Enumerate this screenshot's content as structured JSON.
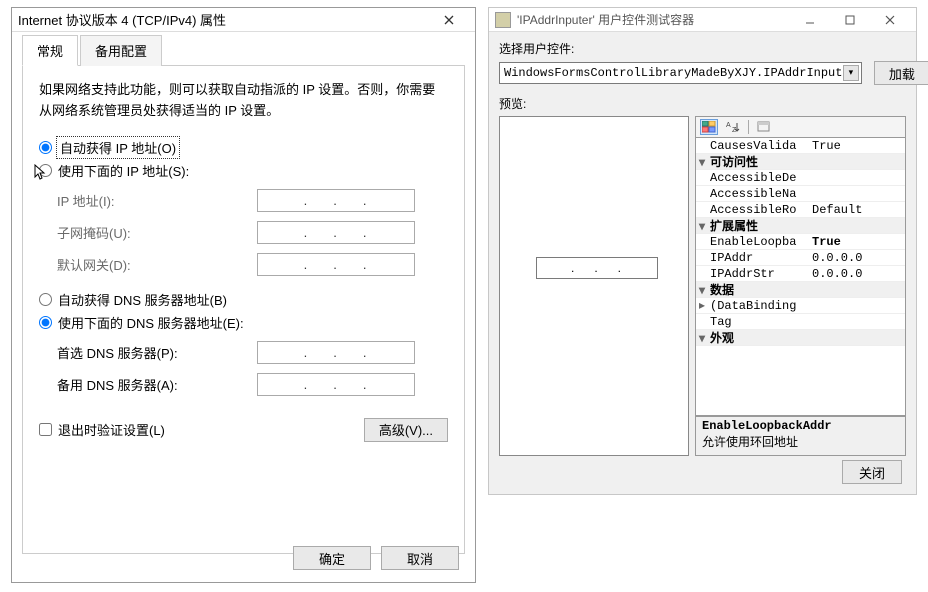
{
  "left": {
    "title": "Internet 协议版本 4 (TCP/IPv4) 属性",
    "tabs": {
      "general": "常规",
      "alt": "备用配置"
    },
    "description": "如果网络支持此功能，则可以获取自动指派的 IP 设置。否则，你需要从网络系统管理员处获得适当的 IP 设置。",
    "radios": {
      "auto_ip": "自动获得 IP 地址(O)",
      "manual_ip": "使用下面的 IP 地址(S):",
      "auto_dns": "自动获得 DNS 服务器地址(B)",
      "manual_dns": "使用下面的 DNS 服务器地址(E):"
    },
    "fields": {
      "ip": "IP 地址(I):",
      "mask": "子网掩码(U):",
      "gateway": "默认网关(D):",
      "dns1": "首选 DNS 服务器(P):",
      "dns2": "备用 DNS 服务器(A):"
    },
    "checkbox_validate": "退出时验证设置(L)",
    "btn_advanced": "高级(V)...",
    "btn_ok": "确定",
    "btn_cancel": "取消"
  },
  "right": {
    "title": "'IPAddrInputer' 用户控件测试容器",
    "label_select": "选择用户控件:",
    "combo_value": "WindowsFormsControlLibraryMadeByXJY.IPAddrInputer",
    "btn_load": "加载",
    "label_preview": "预览:",
    "prop_categories": [
      {
        "expand": "",
        "name": "",
        "rows": [
          {
            "key": "CausesValida",
            "val": "True"
          }
        ]
      },
      {
        "expand": "▾",
        "name": "可访问性",
        "rows": [
          {
            "key": "AccessibleDe",
            "val": ""
          },
          {
            "key": "AccessibleNa",
            "val": ""
          },
          {
            "key": "AccessibleRo",
            "val": "Default"
          }
        ]
      },
      {
        "expand": "▾",
        "name": "扩展属性",
        "rows": [
          {
            "key": "EnableLoopba",
            "val": "True",
            "bold": true
          },
          {
            "key": "IPAddr",
            "val": "0.0.0.0"
          },
          {
            "key": "IPAddrStr",
            "val": "0.0.0.0"
          }
        ]
      },
      {
        "expand": "▾",
        "name": "数据",
        "rows": [
          {
            "key": "(DataBinding",
            "val": "",
            "expandable": "▸"
          },
          {
            "key": "Tag",
            "val": ""
          }
        ]
      },
      {
        "expand": "▾",
        "name": "外观",
        "rows": []
      }
    ],
    "help_name": "EnableLoopbackAddr",
    "help_desc": "允许使用环回地址",
    "btn_close": "关闭"
  }
}
